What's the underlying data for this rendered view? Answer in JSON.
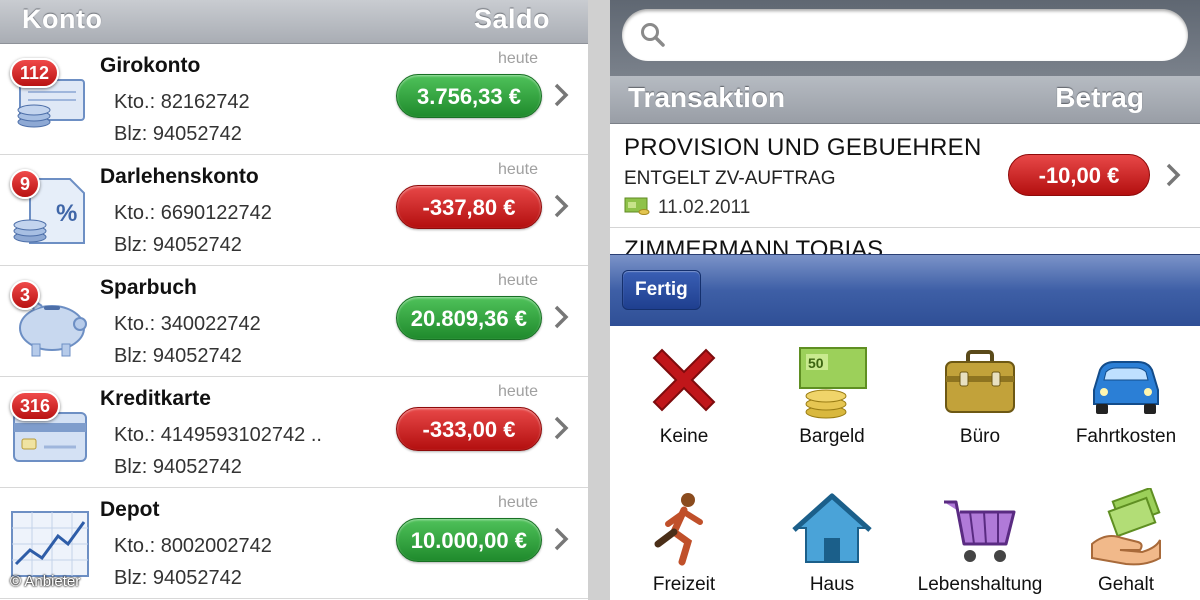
{
  "accounts_panel": {
    "header_title": "Konto",
    "header_balance": "Saldo",
    "accounts": [
      {
        "name": "Girokonto",
        "kto": "Kto.: 82162742",
        "blz": "Blz: 94052742",
        "date": "heute",
        "balance": "3.756,33 €",
        "badge": "112",
        "icon": "bank-account-icon",
        "balance_color": "#2a9c37"
      },
      {
        "name": "Darlehenskonto",
        "kto": "Kto.: 6690122742",
        "blz": "Blz: 94052742",
        "date": "heute",
        "balance": "-337,80 €",
        "badge": "9",
        "icon": "loan-document-icon",
        "balance_color": "#c71818"
      },
      {
        "name": "Sparbuch",
        "kto": "Kto.: 340022742",
        "blz": "Blz: 94052742",
        "date": "heute",
        "balance": "20.809,36 €",
        "badge": "3",
        "icon": "piggy-bank-icon",
        "balance_color": "#2a9c37"
      },
      {
        "name": "Kreditkarte",
        "kto": "Kto.: 4149593102742 ..",
        "blz": "Blz: 94052742",
        "date": "heute",
        "balance": "-333,00 €",
        "badge": "316",
        "icon": "credit-card-icon",
        "balance_color": "#c71818"
      },
      {
        "name": "Depot",
        "kto": "Kto.: 8002002742",
        "blz": "Blz: 94052742",
        "date": "heute",
        "balance": "10.000,00 €",
        "badge": "",
        "icon": "stock-chart-icon",
        "balance_color": "#2a9c37"
      }
    ],
    "credit": "© Anbieter"
  },
  "transactions_panel": {
    "search_placeholder": "",
    "header_title": "Transaktion",
    "header_amount": "Betrag",
    "transaction": {
      "line1": "PROVISION UND GEBUEHREN",
      "line2": "ENTGELT ZV-AUFTRAG",
      "date": "11.02.2011",
      "amount": "-10,00 €",
      "icon": "cash-category-icon"
    },
    "next_transaction_partial": "ZIMMERMANN TOBIAS",
    "done_button": "Fertig",
    "categories": [
      {
        "label": "Keine",
        "icon": "red-x-icon"
      },
      {
        "label": "Bargeld",
        "icon": "cash-icon"
      },
      {
        "label": "Büro",
        "icon": "briefcase-icon"
      },
      {
        "label": "Fahrtkosten",
        "icon": "car-icon"
      },
      {
        "label": "Freizeit",
        "icon": "running-man-icon"
      },
      {
        "label": "Haus",
        "icon": "house-icon"
      },
      {
        "label": "Lebenshaltung",
        "icon": "shopping-cart-icon"
      },
      {
        "label": "Gehalt",
        "icon": "salary-hand-icon"
      }
    ],
    "colors": {
      "toolbar": "#3e5fa6",
      "negative": "#c71818",
      "positive": "#2a9c37"
    }
  }
}
